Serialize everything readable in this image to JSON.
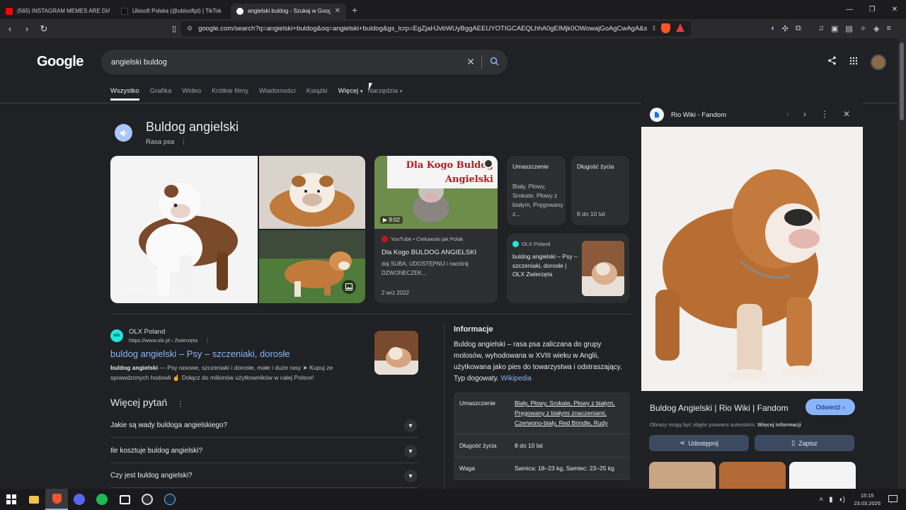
{
  "browser": {
    "tabs": [
      {
        "title": "(565) INSTAGRAM MEMES ARE DIABOLICAL",
        "favicon_color": "#ff0000"
      },
      {
        "title": "Ubisoft Polska (@ubisoftpl) | TikTok",
        "favicon_color": "#111111"
      },
      {
        "title": "angielski buldog - Szukaj w Google",
        "favicon_color": "#ffffff"
      }
    ],
    "new_tab": "+",
    "url": "google.com/search?q=angielski+buldog&oq=angielski+buldog&gs_lcrp=EgZjaHJvbWUyBggAEEUYOTIGCAEQLhhA0gEIMjk0OWowajGoAgCwAgA&s..."
  },
  "google": {
    "logo": "Google",
    "query": "angielski buldog",
    "tabs": [
      "Wszystko",
      "Grafika",
      "Wideo",
      "Krótkie filmy",
      "Wiadomości",
      "Książki"
    ],
    "more": "Więcej",
    "tools": "Narzędzia"
  },
  "knowledge": {
    "title": "Buldog angielski",
    "subtitle": "Rasa psa",
    "image_source": "Źródło: Rasidia",
    "video": {
      "banner": "Dla Kogo Buldog Angielski",
      "duration": "9:02",
      "source": "YouTube • Ciekawski jak Polak",
      "title": "Dla Kogo BULDOG ANGIELSKI",
      "desc": "daj SUBA, UDOSTĘPNIJ i naciśnij DZWONECZEK...",
      "date": "2 wrz 2022"
    },
    "card_color": {
      "label": "Umaszczenie",
      "value": "Biały, Płowy, Srokate, Płowy z białym, Pręgowany z..."
    },
    "card_life": {
      "label": "Długość życia",
      "value": "8 do 10 lat"
    },
    "card_olx": {
      "source": "OLX Poland",
      "desc": "buldog angielski – Psy – szczeniaki, dorosłe | OLX Zwierzęta"
    }
  },
  "result": {
    "site": "OLX Poland",
    "url": "https://www.olx.pl › Zwierzęta",
    "title": "buldog angielski – Psy – szczeniaki, dorosłe",
    "snippet_bold": "buldog angielski",
    "snippet": " — Psy rasowe, szczeniaki i dorosłe, małe i duże rasy ➤ Kupuj ze sprawdzonych hodowli ☝ Dołącz do milionów użytkowników w całej Polsce!"
  },
  "paa": {
    "title": "Więcej pytań",
    "questions": [
      "Jakie są wady buldoga angielskiego?",
      "Ile kosztuje buldog angielski?",
      "Czy jest buldog angielski?"
    ]
  },
  "info": {
    "title": "Informacje",
    "text": "Buldog angielski – rasa psa zaliczana do grupy molosów, wyhodowana w XVIII wieku w Anglii, użytkowana jako pies do towarzystwa i odstraszający. Typ dogowaty. ",
    "link": "Wikipedia",
    "facts": [
      {
        "k": "Umaszczenie",
        "v": "Biały, Płowy, Srokate, Płowy z białym, Pręgowany z białymi znaczeniami, Czerwono-biały, Red Brindle, Rudy"
      },
      {
        "k": "Długość życia",
        "v": "8 do 10 lat"
      },
      {
        "k": "Waga",
        "v": "Samica: 18–23 kg, Samiec: 23–25 kg"
      }
    ]
  },
  "side": {
    "source": "Rio Wiki - Fandom",
    "title": "Buldog Angielski | Rio Wiki | Fandom",
    "visit": "Odwiedź",
    "copyright": "Obrazy mogą być objęte prawami autorskimi.",
    "more_info": "Więcej informacji",
    "share": "Udostępnij",
    "save": "Zapisz"
  },
  "taskbar": {
    "time": "15:15",
    "date": "23.03.2026"
  }
}
